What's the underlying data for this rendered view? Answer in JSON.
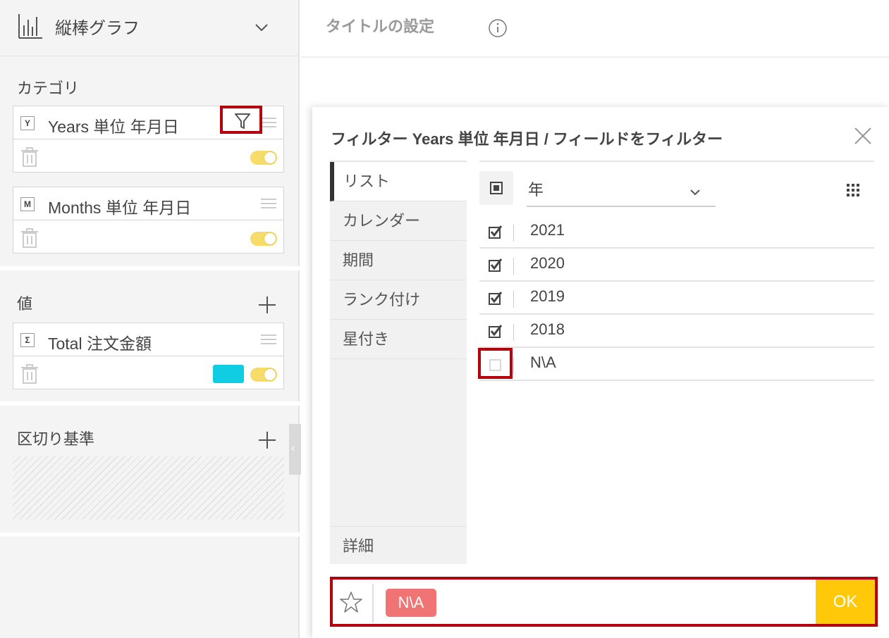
{
  "chart_selector": {
    "label": "縦棒グラフ",
    "icon": "bar-chart-icon"
  },
  "header": {
    "title_setting": "タイトルの設定",
    "info_icon": "info-icon"
  },
  "sections": {
    "category": {
      "title": "カテゴリ"
    },
    "values": {
      "title": "値"
    },
    "split_by": {
      "title": "区切り基準"
    }
  },
  "fields": {
    "years": {
      "badge": "Y",
      "name": "Years 単位 年月日"
    },
    "months": {
      "badge": "M",
      "name": "Months 単位 年月日"
    },
    "total": {
      "badge": "Σ",
      "name": "Total 注文金額",
      "color": "#10cde4"
    }
  },
  "dialog": {
    "title": "フィルター Years 単位 年月日 / フィールドをフィルター",
    "tabs": [
      "リスト",
      "カレンダー",
      "期間",
      "ランク付け",
      "星付き"
    ],
    "detail_tab": "詳細",
    "year_select": "年",
    "items": [
      {
        "label": "2021",
        "checked": true
      },
      {
        "label": "2020",
        "checked": true
      },
      {
        "label": "2019",
        "checked": true
      },
      {
        "label": "2018",
        "checked": true
      },
      {
        "label": "N\\A",
        "checked": false
      }
    ]
  },
  "bottom_bar": {
    "chip": "N\\A",
    "ok": "OK"
  },
  "colors": {
    "highlight": "#b3000d",
    "ok": "#ffc808",
    "chip": "#f07473",
    "toggle": "#f8dc6a"
  }
}
